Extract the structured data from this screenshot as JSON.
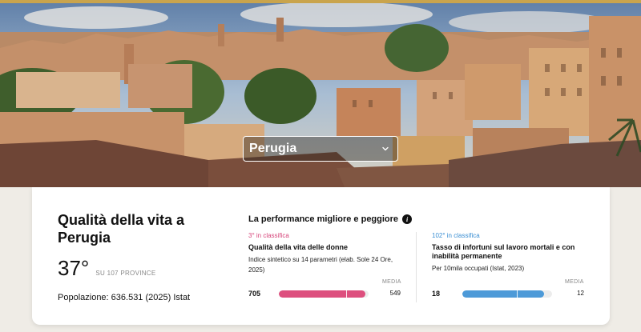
{
  "hero": {
    "city_select": {
      "selected": "Perugia"
    }
  },
  "card": {
    "title": "Qualità della vita a Perugia",
    "rank": "37°",
    "rank_sub": "SU 107 PROVINCE",
    "population": "Popolazione: 636.531 (2025) Istat"
  },
  "performance": {
    "title": "La performance migliore e peggiore",
    "best": {
      "rank": "3° in classifica",
      "name": "Qualità della vita delle donne",
      "description": "Indice sintetico su 14 parametri (elab. Sole 24 Ore, 2025)",
      "media_label": "MEDIA",
      "value": "705",
      "average": "549",
      "fill_fraction": 0.96,
      "average_fraction": 0.75,
      "color": "#dd4f7e"
    },
    "worst": {
      "rank": "102° in classifica",
      "name": "Tasso di infortuni sul lavoro mortali e con inabilità permanente",
      "description": "Per 10mila occupati (Istat, 2023)",
      "media_label": "MEDIA",
      "value": "18",
      "average": "12",
      "fill_fraction": 0.91,
      "average_fraction": 0.61,
      "color": "#4d9ad8"
    }
  }
}
